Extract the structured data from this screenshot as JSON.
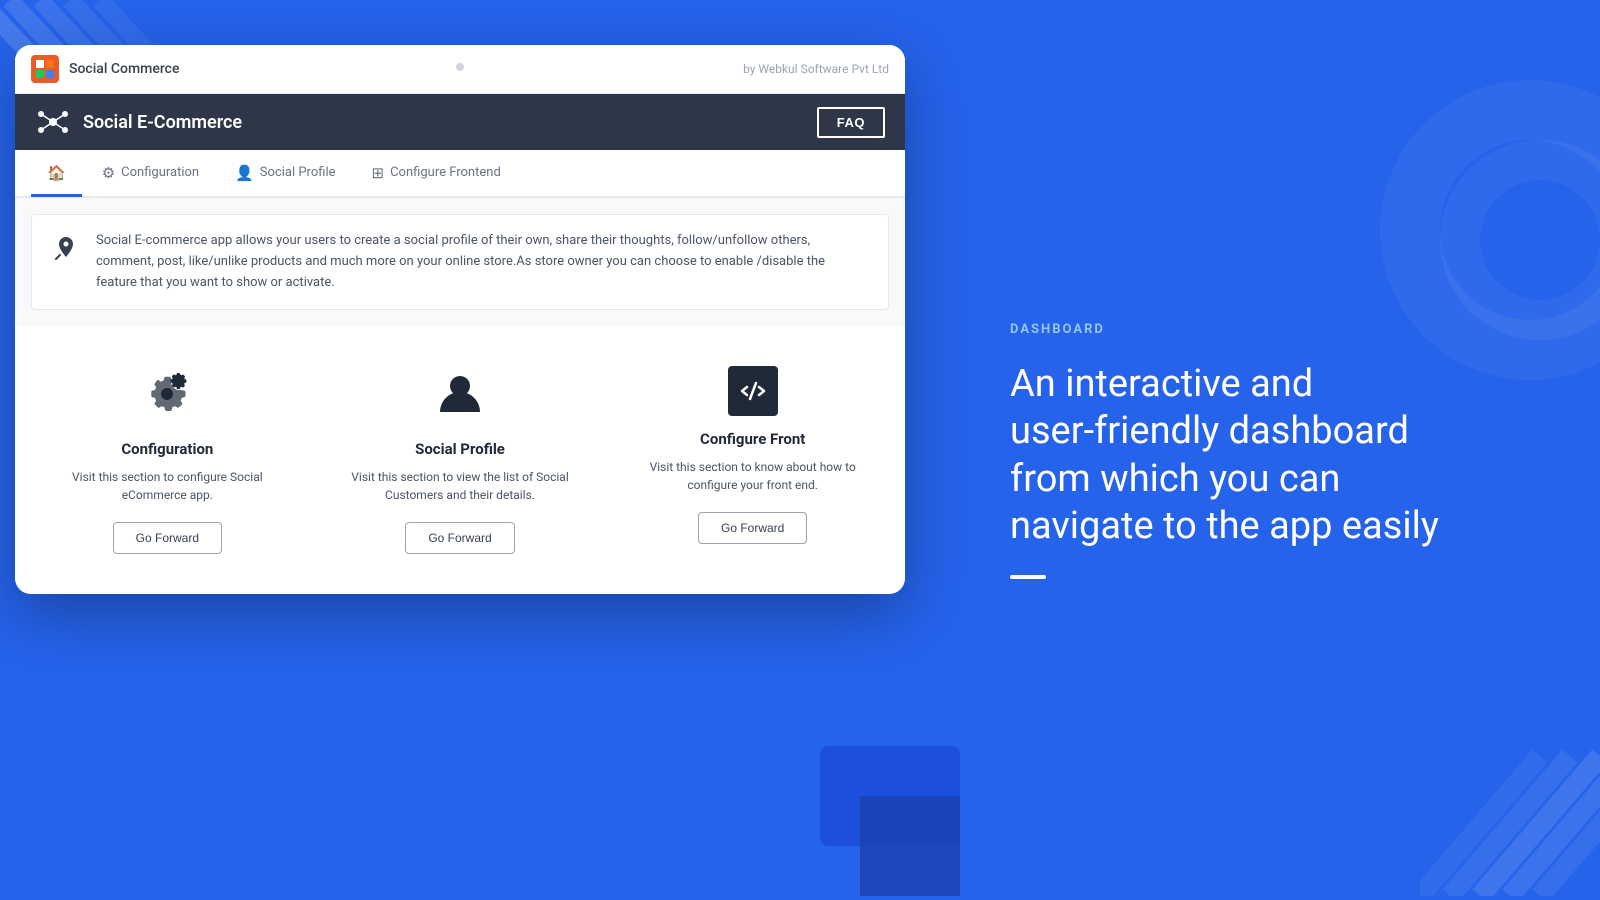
{
  "left": {
    "browser": {
      "app_icon_text": "S",
      "app_title": "Social Commerce",
      "by_text": "by Webkul Software Pvt Ltd"
    },
    "nav": {
      "brand_name": "Social E-Commerce",
      "faq_label": "FAQ"
    },
    "tabs": [
      {
        "label": "Home",
        "icon": "🏠",
        "active": true
      },
      {
        "label": "Configuration",
        "icon": "⚙",
        "active": false
      },
      {
        "label": "Social Profile",
        "icon": "👤",
        "active": false
      },
      {
        "label": "Configure Frontend",
        "icon": "⊞",
        "active": false
      }
    ],
    "info_text": "Social E-commerce app allows your users to create a social profile of their own, share their thoughts, follow/unfollow others, comment, post, like/unlike products and much more on your online store.As store owner you can choose to enable /disable the feature that you want to show or activate.",
    "cards": [
      {
        "id": "configuration",
        "title": "Configuration",
        "desc": "Visit this section to configure Social eCommerce app.",
        "btn_label": "Go Forward"
      },
      {
        "id": "social-profile",
        "title": "Social Profile",
        "desc": "Visit this section to view the list of Social Customers and their details.",
        "btn_label": "Go Forward"
      },
      {
        "id": "configure-front",
        "title": "Configure Front",
        "desc": "Visit this section to know about how to configure your front end.",
        "btn_label": "Go Forward"
      }
    ]
  },
  "right": {
    "label": "DASHBOARD",
    "heading_line1": "An interactive and",
    "heading_line2": "user-friendly dashboard",
    "heading_line3": "from which you can",
    "heading_line4": "navigate to the app easily"
  }
}
